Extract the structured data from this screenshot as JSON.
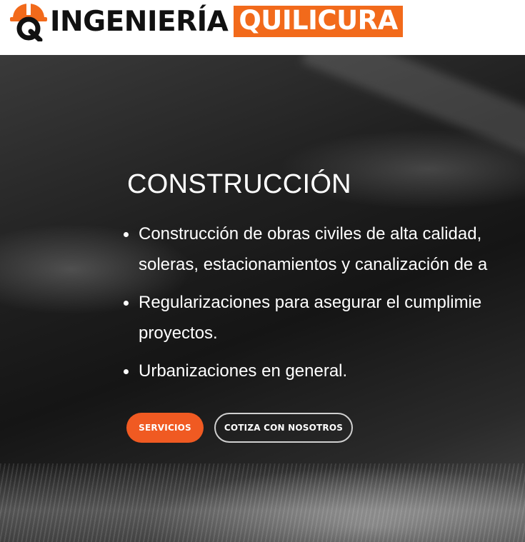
{
  "header": {
    "logo_word": "INGENIERÍA",
    "logo_badge": "QUILICURA",
    "brand_orange": "#f26a1b",
    "logo_icon": "helmet-q-icon"
  },
  "hero": {
    "title": "CONSTRUCCIÓN",
    "items": [
      {
        "text": "Construcción de obras civiles de alta calidad, soleras, estacionamientos y canalización de a"
      },
      {
        "text": "Regularizaciones para asegurar el cumplimie proyectos."
      },
      {
        "text": "Urbanizaciones en general."
      }
    ],
    "buttons": {
      "primary": "SERVICIOS",
      "secondary": "COTIZA CON NOSOTROS"
    },
    "accent": "#f05a22"
  }
}
